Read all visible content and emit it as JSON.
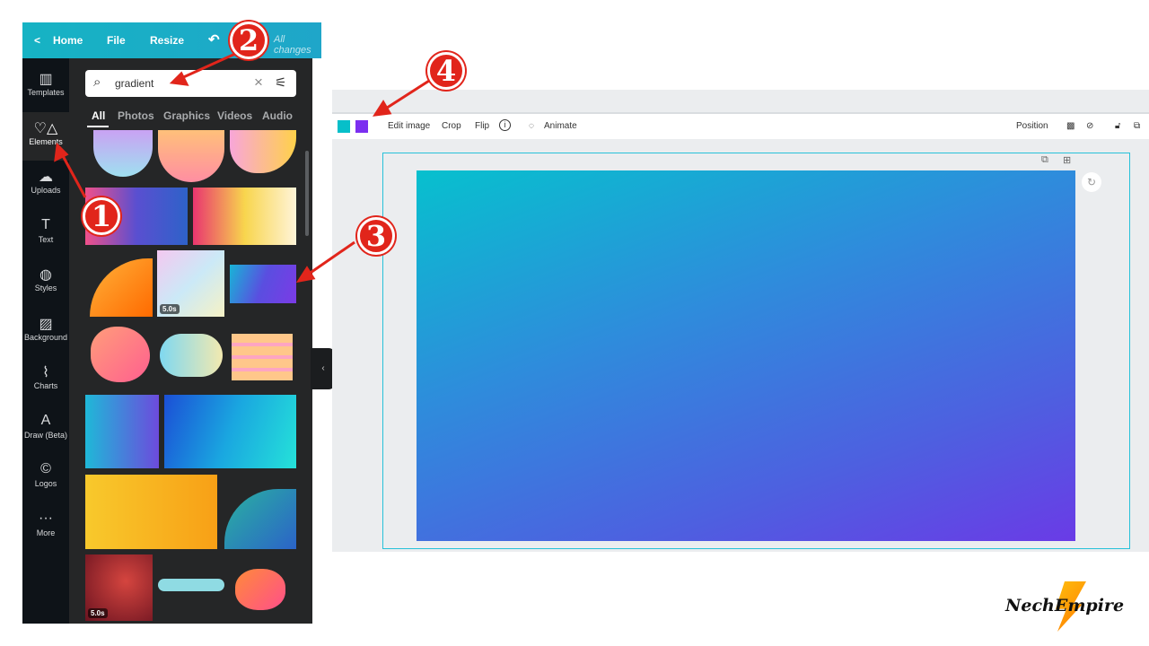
{
  "topbar": {
    "back": "<",
    "home": "Home",
    "file": "File",
    "resize": "Resize",
    "undo": "↶",
    "status": "All changes"
  },
  "rail": [
    {
      "label": "Templates",
      "icon": "▥"
    },
    {
      "label": "Elements",
      "icon": "♡△"
    },
    {
      "label": "Uploads",
      "icon": "☁"
    },
    {
      "label": "Text",
      "icon": "T"
    },
    {
      "label": "Styles",
      "icon": "◍"
    },
    {
      "label": "Background",
      "icon": "▨"
    },
    {
      "label": "Charts",
      "icon": "⌇"
    },
    {
      "label": "Draw (Beta)",
      "icon": "A"
    },
    {
      "label": "Logos",
      "icon": "©"
    },
    {
      "label": "More",
      "icon": "···"
    }
  ],
  "search": {
    "value": "gradient",
    "clear": "×",
    "filter": "⚟"
  },
  "tabs": [
    "All",
    "Photos",
    "Graphics",
    "Videos",
    "Audio"
  ],
  "durations": [
    "5.0s",
    "5.0s"
  ],
  "toolbar": {
    "colors": [
      "#07bfc9",
      "#7b2ff0"
    ],
    "edit_image": "Edit image",
    "crop": "Crop",
    "flip": "Flip",
    "info": "i",
    "animate": "Animate",
    "position": "Position"
  },
  "annotations": [
    "1",
    "2",
    "3",
    "4"
  ],
  "watermark": "NechEmpire"
}
